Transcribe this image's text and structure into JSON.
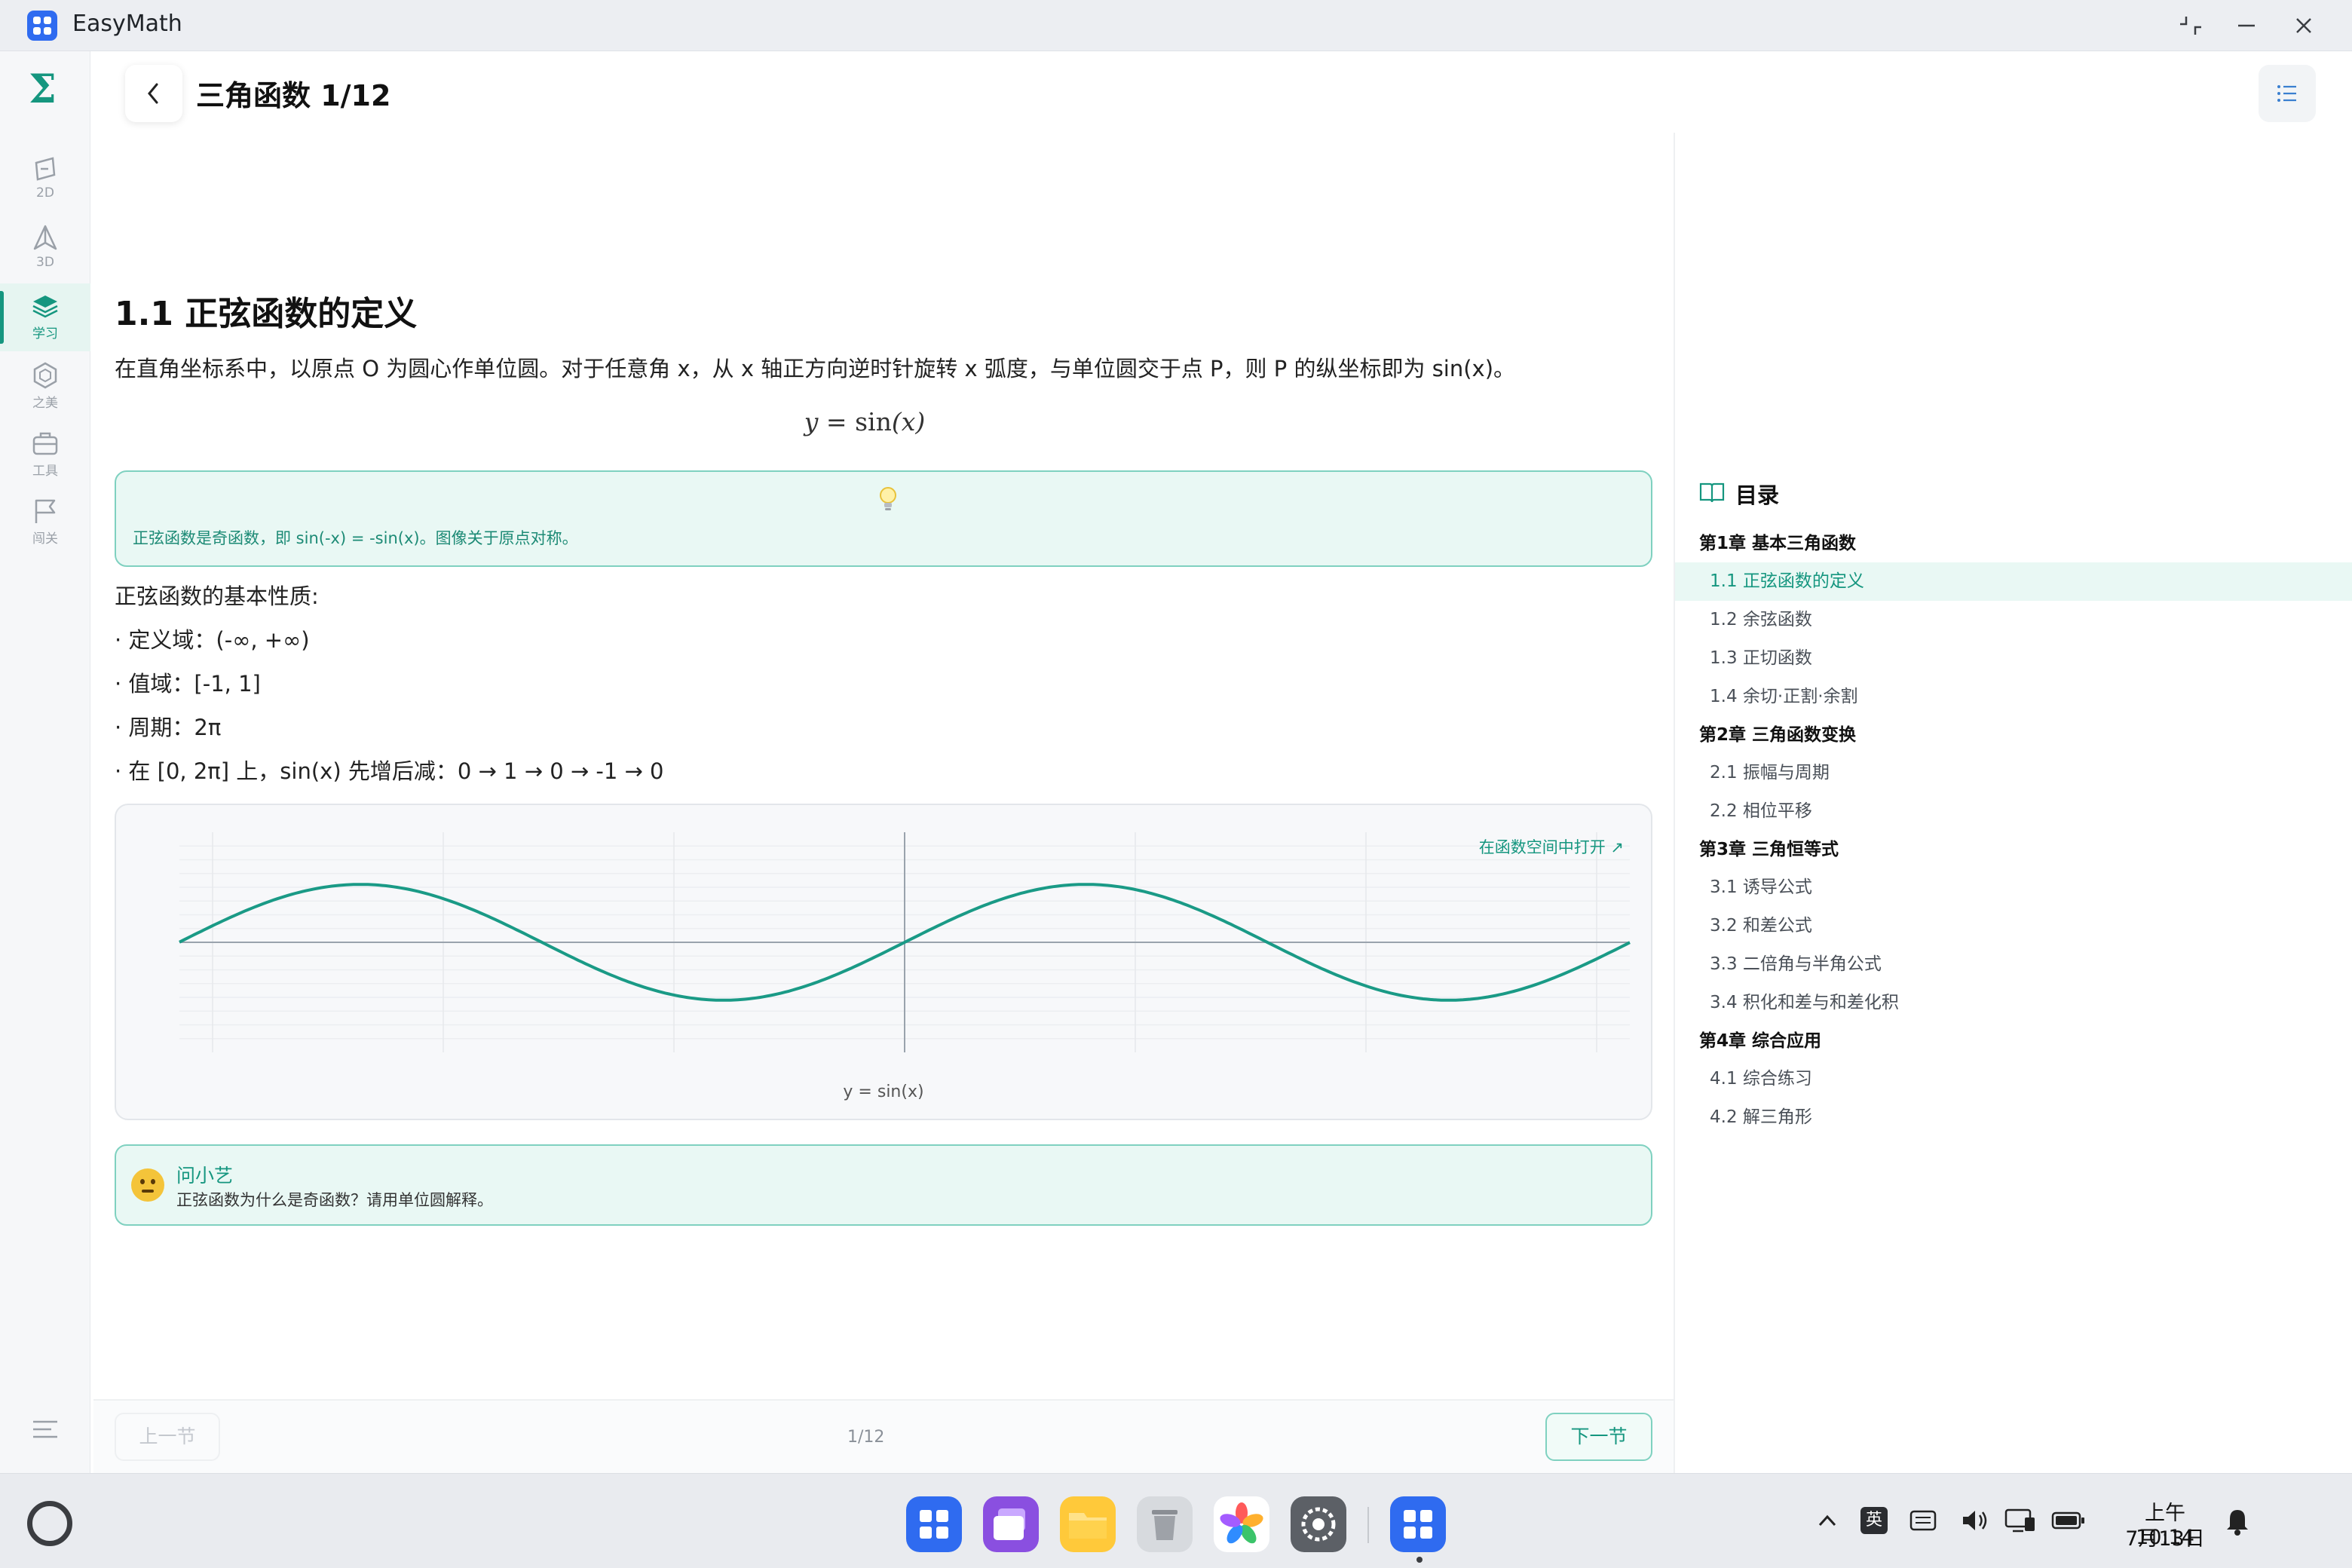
{
  "window": {
    "app_title": "EasyMath",
    "controls": [
      "restore-icon",
      "minimize-icon",
      "close-icon"
    ]
  },
  "sidebar": {
    "logo": "Σ",
    "items": [
      {
        "label": "2D",
        "icon": "plane-2d-icon"
      },
      {
        "label": "3D",
        "icon": "pyramid-3d-icon"
      },
      {
        "label": "学习",
        "icon": "layers-icon",
        "active": true
      },
      {
        "label": "之美",
        "icon": "hexagon-icon"
      },
      {
        "label": "工具",
        "icon": "toolbox-icon"
      },
      {
        "label": "闯关",
        "icon": "flag-icon"
      }
    ],
    "bottom_icon": "menu-collapse-icon"
  },
  "header": {
    "title": "三角函数  1/12"
  },
  "content": {
    "section_title": "1.1 正弦函数的定义",
    "intro": "在直角坐标系中，以原点 O 为圆心作单位圆。对于任意角 x，从 x 轴正方向逆时针旋转 x 弧度，与单位圆交于点 P，则 P 的纵坐标即为 sin(x)。",
    "formula": {
      "lhs": "y",
      "eq": " = ",
      "fn": "sin",
      "arg": "(x)"
    },
    "tip": {
      "icon": "lightbulb-icon",
      "text": "正弦函数是奇函数，即 sin(-x) = -sin(x)。图像关于原点对称。"
    },
    "props_title": "正弦函数的基本性质:",
    "props": [
      "· 定义域：(-∞, +∞)",
      "· 值域：[-1, 1]",
      "· 周期：2π",
      "· 在 [0, 2π] 上，sin(x) 先增后减：0 → 1 → 0 → -1 → 0"
    ],
    "plot": {
      "open_link": "在函数空间中打开 ↗",
      "caption": "y = sin(x)"
    },
    "ask": {
      "name": "问小艺",
      "question": "正弦函数为什么是奇函数？请用单位圆解释。"
    }
  },
  "chart_data": {
    "type": "line",
    "function": "sin(x)",
    "xlim": [
      -6.28,
      6.28
    ],
    "ylim": [
      -1.9,
      1.9
    ],
    "grid": true,
    "series": [
      {
        "name": "y = sin(x)",
        "color": "#1a9a86"
      }
    ]
  },
  "footer": {
    "prev": "上一节",
    "pager": "1/12",
    "next": "下一节"
  },
  "toc": {
    "title": "目录",
    "chapters": [
      {
        "title": "第1章 基本三角函数",
        "sections": [
          "1.1 正弦函数的定义",
          "1.2 余弦函数",
          "1.3 正切函数",
          "1.4 余切·正割·余割"
        ]
      },
      {
        "title": "第2章 三角函数变换",
        "sections": [
          "2.1 振幅与周期",
          "2.2 相位平移"
        ]
      },
      {
        "title": "第3章 三角恒等式",
        "sections": [
          "3.1 诱导公式",
          "3.2 和差公式",
          "3.3 二倍角与半角公式",
          "3.4 积化和差与和差化积"
        ]
      },
      {
        "title": "第4章 综合应用",
        "sections": [
          "4.1 综合练习",
          "4.2 解三角形"
        ]
      }
    ],
    "active": "1.1 正弦函数的定义"
  },
  "taskbar": {
    "apps": [
      "app-grid-icon",
      "window-stack-icon",
      "folder-icon",
      "trash-icon",
      "photos-icon",
      "settings-gear-icon",
      "easymath-app-icon"
    ],
    "ime": "英",
    "clock_time": "上午10:14",
    "clock_date": "7月13日"
  },
  "colors": {
    "accent": "#15967f",
    "accent_light": "#e9f8f4",
    "border_accent": "#7fd1c0"
  }
}
